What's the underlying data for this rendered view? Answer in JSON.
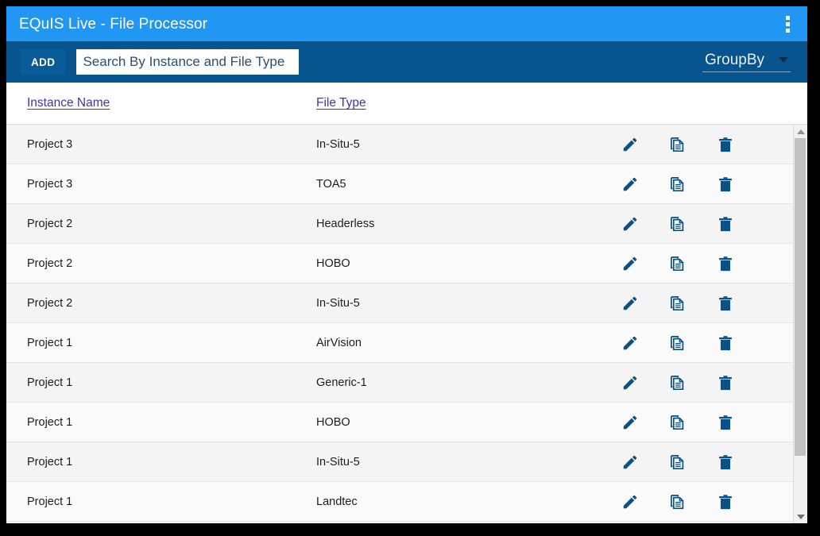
{
  "window": {
    "title": "EQuIS Live - File Processor",
    "menu_icon": "kebab-menu-icon"
  },
  "toolbar": {
    "add_label": "ADD",
    "search_placeholder": "Search By Instance and File Type",
    "search_value": "",
    "groupby_label": "GroupBy"
  },
  "table": {
    "columns": [
      {
        "key": "instance_name",
        "label": "Instance Name"
      },
      {
        "key": "file_type",
        "label": "File Type"
      }
    ],
    "row_actions": [
      {
        "name": "edit-icon",
        "label": "Edit"
      },
      {
        "name": "copy-icon",
        "label": "Copy"
      },
      {
        "name": "delete-icon",
        "label": "Delete"
      }
    ],
    "rows": [
      {
        "instance_name": "Project 3",
        "file_type": "In-Situ-5"
      },
      {
        "instance_name": "Project 3",
        "file_type": "TOA5"
      },
      {
        "instance_name": "Project 2",
        "file_type": "Headerless"
      },
      {
        "instance_name": "Project 2",
        "file_type": "HOBO"
      },
      {
        "instance_name": "Project 2",
        "file_type": "In-Situ-5"
      },
      {
        "instance_name": "Project 1",
        "file_type": "AirVision"
      },
      {
        "instance_name": "Project 1",
        "file_type": "Generic-1"
      },
      {
        "instance_name": "Project 1",
        "file_type": "HOBO"
      },
      {
        "instance_name": "Project 1",
        "file_type": "In-Situ-5"
      },
      {
        "instance_name": "Project 1",
        "file_type": "Landtec"
      }
    ]
  },
  "colors": {
    "titlebar": "#2196f3",
    "toolbar": "#07548f",
    "accent_icon": "#0a5185",
    "header_link": "#4b2ea8",
    "row_odd": "#f4f4f4",
    "row_even": "#fafafa"
  },
  "scrollbar": {
    "up_arrow": "scroll-up-arrow-icon",
    "down_arrow": "scroll-down-arrow-icon"
  }
}
